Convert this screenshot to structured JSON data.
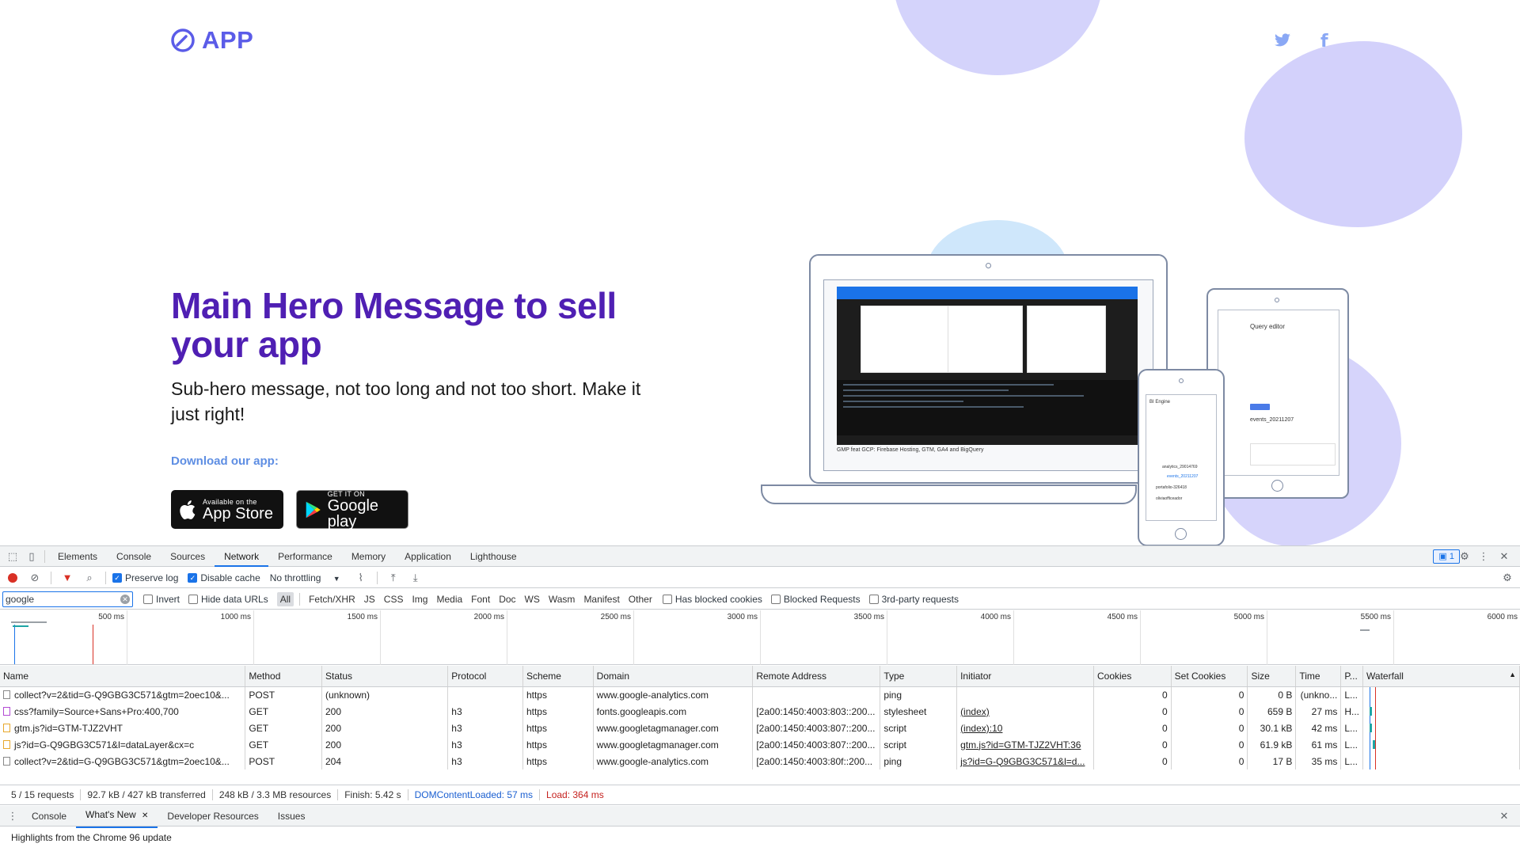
{
  "landing": {
    "logo_text": "APP",
    "hero_title": "Main Hero Message to sell your app",
    "hero_subtitle": "Sub-hero message, not too long and not too short. Make it just right!",
    "download_label": "Download our app:",
    "app_store": {
      "small": "Available on the",
      "big": "App Store"
    },
    "google_play": {
      "small": "GET IT ON",
      "big": "Google play"
    },
    "laptop_caption": "GMP feat GCP: Firebase Hosting, GTM, GA4 and BigQuery",
    "tablet_title": "Query editor",
    "tablet_table": "events_20211207",
    "phone_title": "BI Engine",
    "phone_items": [
      "analytics_29014769",
      "events_20211207",
      "portafolio-326418",
      "oliviaofficeador"
    ]
  },
  "devtools": {
    "tabs": [
      "Elements",
      "Console",
      "Sources",
      "Network",
      "Performance",
      "Memory",
      "Application",
      "Lighthouse"
    ],
    "active_tab": "Network",
    "issues_badge": "1",
    "toolbar": {
      "preserve_log": "Preserve log",
      "disable_cache": "Disable cache",
      "throttling": "No throttling"
    },
    "filter": {
      "value": "google",
      "invert": "Invert",
      "hide_data_urls": "Hide data URLs",
      "types": [
        "All",
        "Fetch/XHR",
        "JS",
        "CSS",
        "Img",
        "Media",
        "Font",
        "Doc",
        "WS",
        "Wasm",
        "Manifest",
        "Other"
      ],
      "has_blocked_cookies": "Has blocked cookies",
      "blocked_requests": "Blocked Requests",
      "third_party": "3rd-party requests"
    },
    "timeline_ticks": [
      "500 ms",
      "1000 ms",
      "1500 ms",
      "2000 ms",
      "2500 ms",
      "3000 ms",
      "3500 ms",
      "4000 ms",
      "4500 ms",
      "5000 ms",
      "5500 ms",
      "6000 ms"
    ],
    "columns": [
      "Name",
      "Method",
      "Status",
      "Protocol",
      "Scheme",
      "Domain",
      "Remote Address",
      "Type",
      "Initiator",
      "Cookies",
      "Set Cookies",
      "Size",
      "Time",
      "P...",
      "Waterfall"
    ],
    "rows": [
      {
        "icon": "doc",
        "name": "collect?v=2&tid=G-Q9GBG3C571&gtm=2oec10&...",
        "method": "POST",
        "status": "(unknown)",
        "protocol": "",
        "scheme": "https",
        "domain": "www.google-analytics.com",
        "remote": "",
        "type": "ping",
        "initiator": "",
        "cookies": "0",
        "set_cookies": "0",
        "size": "0 B",
        "time": "(unkno...",
        "priority": "L..."
      },
      {
        "icon": "css",
        "name": "css?family=Source+Sans+Pro:400,700",
        "method": "GET",
        "status": "200",
        "protocol": "h3",
        "scheme": "https",
        "domain": "fonts.googleapis.com",
        "remote": "[2a00:1450:4003:803::200...",
        "type": "stylesheet",
        "initiator": "(index)",
        "cookies": "0",
        "set_cookies": "0",
        "size": "659 B",
        "time": "27 ms",
        "priority": "H..."
      },
      {
        "icon": "js",
        "name": "gtm.js?id=GTM-TJZ2VHT",
        "method": "GET",
        "status": "200",
        "protocol": "h3",
        "scheme": "https",
        "domain": "www.googletagmanager.com",
        "remote": "[2a00:1450:4003:807::200...",
        "type": "script",
        "initiator": "(index):10",
        "cookies": "0",
        "set_cookies": "0",
        "size": "30.1 kB",
        "time": "42 ms",
        "priority": "L..."
      },
      {
        "icon": "js",
        "name": "js?id=G-Q9GBG3C571&l=dataLayer&cx=c",
        "method": "GET",
        "status": "200",
        "protocol": "h3",
        "scheme": "https",
        "domain": "www.googletagmanager.com",
        "remote": "[2a00:1450:4003:807::200...",
        "type": "script",
        "initiator": "gtm.js?id=GTM-TJZ2VHT:36",
        "cookies": "0",
        "set_cookies": "0",
        "size": "61.9 kB",
        "time": "61 ms",
        "priority": "L..."
      },
      {
        "icon": "doc",
        "name": "collect?v=2&tid=G-Q9GBG3C571&gtm=2oec10&...",
        "method": "POST",
        "status": "204",
        "protocol": "h3",
        "scheme": "https",
        "domain": "www.google-analytics.com",
        "remote": "[2a00:1450:4003:80f::200...",
        "type": "ping",
        "initiator": "js?id=G-Q9GBG3C571&l=d...",
        "cookies": "0",
        "set_cookies": "0",
        "size": "17 B",
        "time": "35 ms",
        "priority": "L..."
      }
    ],
    "status": {
      "requests": "5 / 15 requests",
      "transferred": "92.7 kB / 427 kB transferred",
      "resources": "248 kB / 3.3 MB resources",
      "finish": "Finish: 5.42 s",
      "dcl": "DOMContentLoaded: 57 ms",
      "load": "Load: 364 ms"
    },
    "drawer": {
      "tabs": [
        "Console",
        "What's New",
        "Developer Resources",
        "Issues"
      ],
      "active": "What's New",
      "content": "Highlights from the Chrome 96 update"
    },
    "colors": {
      "accent": "#1a73e8",
      "hero": "#4f1fb3",
      "record": "#d93025"
    }
  }
}
